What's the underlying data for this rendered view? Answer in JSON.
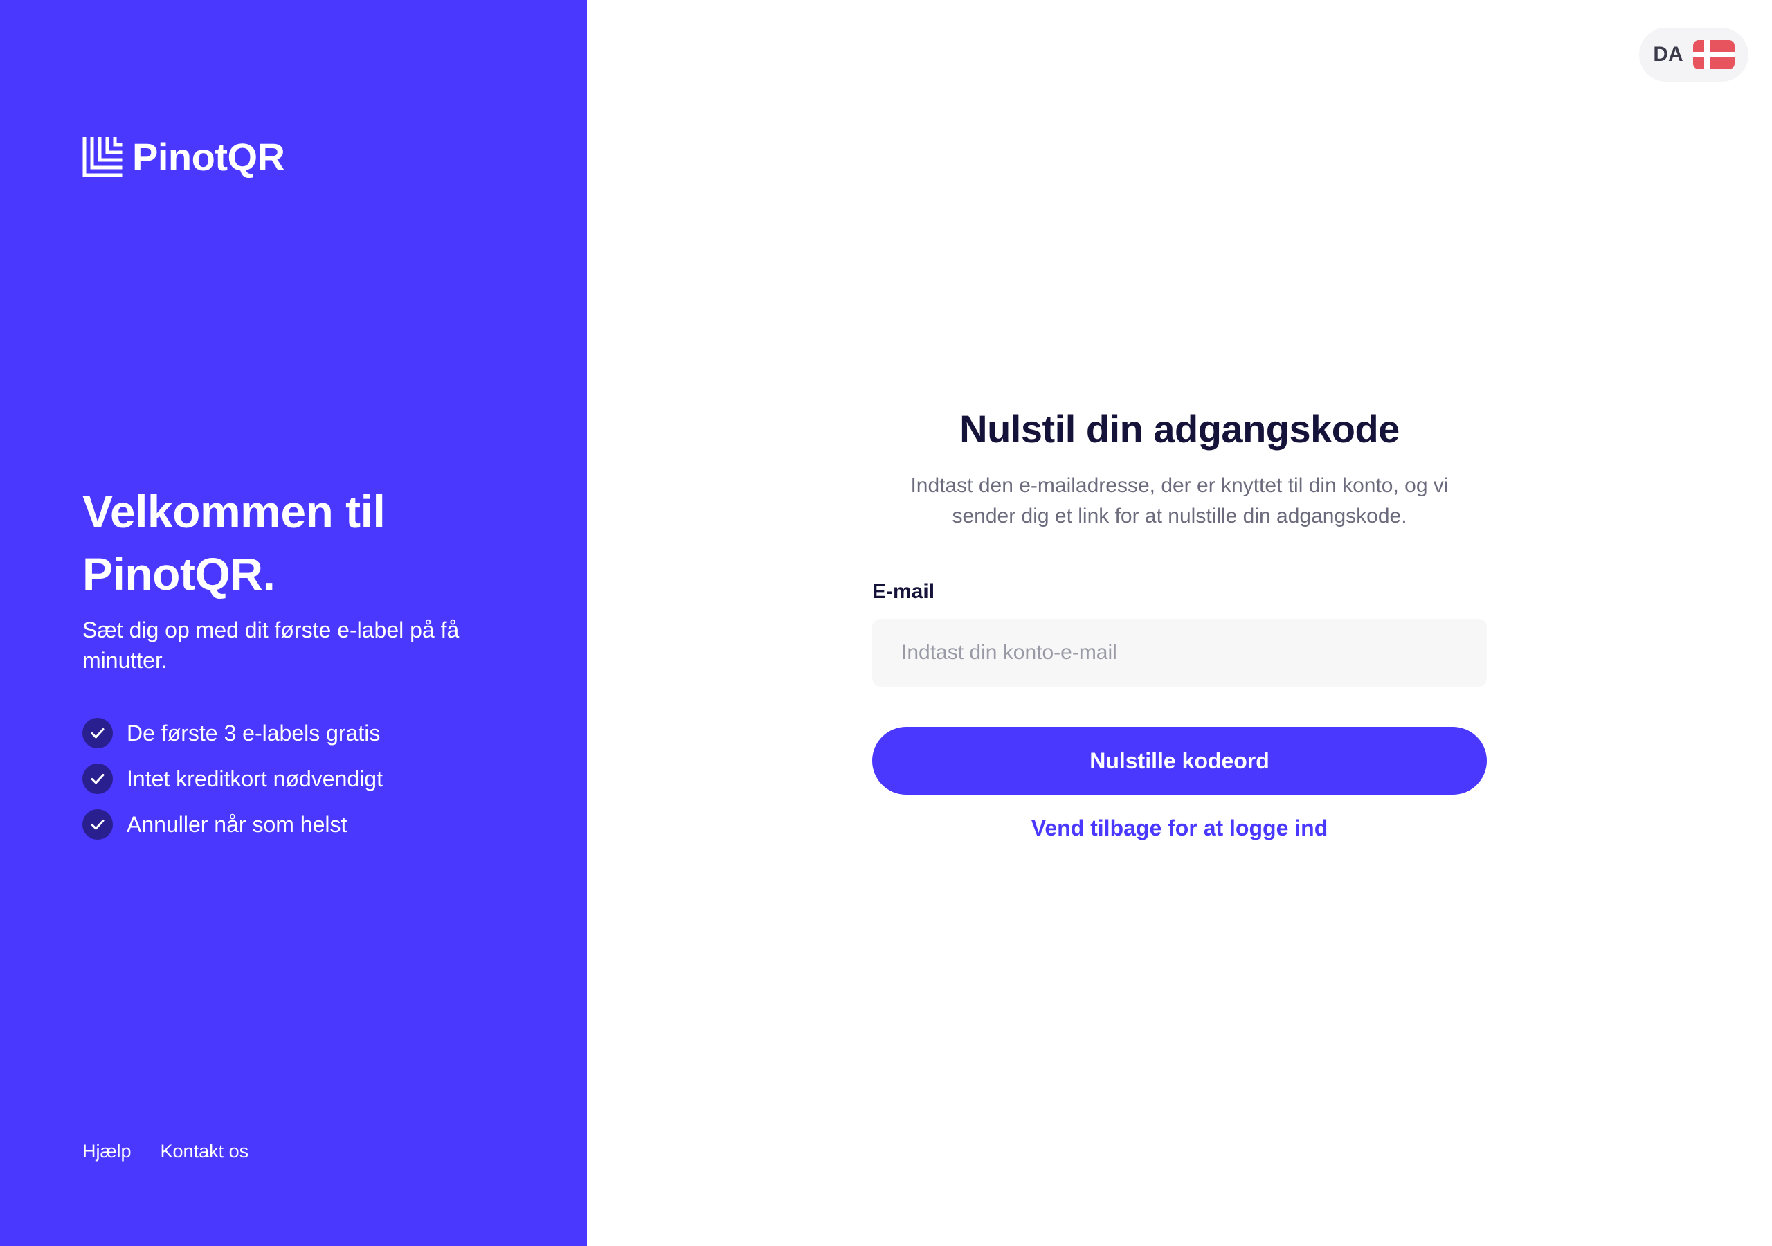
{
  "brand": {
    "name": "PinotQR",
    "primary_color": "#4a38fe",
    "logo_icon": "pinotqr-logo-icon"
  },
  "left_panel": {
    "welcome_title": "Velkommen til PinotQR.",
    "welcome_subtitle": "Sæt dig op med dit første e-label på få minutter.",
    "benefits": [
      {
        "icon": "check-icon",
        "label": "De første 3 e-labels gratis"
      },
      {
        "icon": "check-icon",
        "label": "Intet kreditkort nødvendigt"
      },
      {
        "icon": "check-icon",
        "label": "Annuller når som helst"
      }
    ],
    "footer_links": [
      {
        "label": "Hjælp"
      },
      {
        "label": "Kontakt os"
      }
    ]
  },
  "language_switcher": {
    "code": "DA",
    "flag_icon": "denmark-flag-icon"
  },
  "form": {
    "title": "Nulstil din adgangskode",
    "description": "Indtast den e-mailadresse, der er knyttet til din konto, og vi sender dig et link for at nulstille din adgangskode.",
    "email_label": "E-mail",
    "email_value": "",
    "email_placeholder": "Indtast din konto-e-mail",
    "submit_label": "Nulstille kodeord",
    "back_link_label": "Vend tilbage for at logge ind"
  }
}
